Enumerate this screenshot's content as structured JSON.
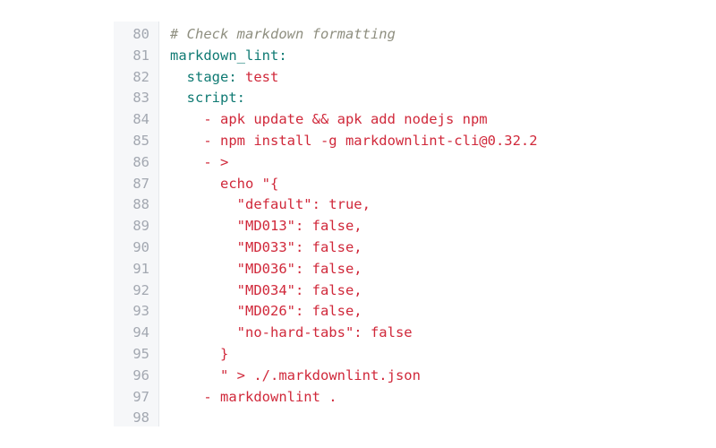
{
  "editor": {
    "lines": [
      {
        "number": "80",
        "indent": "",
        "tokens": [
          {
            "text": "# Check markdown formatting",
            "kind": "comment"
          }
        ]
      },
      {
        "number": "81",
        "indent": "",
        "tokens": [
          {
            "text": "markdown_lint:",
            "kind": "key"
          }
        ]
      },
      {
        "number": "82",
        "indent": "  ",
        "tokens": [
          {
            "text": "stage:",
            "kind": "key"
          },
          {
            "text": " test",
            "kind": "str"
          }
        ]
      },
      {
        "number": "83",
        "indent": "  ",
        "tokens": [
          {
            "text": "script:",
            "kind": "key"
          }
        ]
      },
      {
        "number": "84",
        "indent": "    ",
        "tokens": [
          {
            "text": "- apk update && apk add nodejs npm",
            "kind": "str"
          }
        ]
      },
      {
        "number": "85",
        "indent": "    ",
        "tokens": [
          {
            "text": "- npm install -g markdownlint-cli@0.32.2",
            "kind": "str"
          }
        ]
      },
      {
        "number": "86",
        "indent": "    ",
        "tokens": [
          {
            "text": "- >",
            "kind": "str"
          }
        ]
      },
      {
        "number": "87",
        "indent": "      ",
        "tokens": [
          {
            "text": "echo \"{",
            "kind": "str"
          }
        ]
      },
      {
        "number": "88",
        "indent": "        ",
        "tokens": [
          {
            "text": "\"default\": true,",
            "kind": "str"
          }
        ]
      },
      {
        "number": "89",
        "indent": "        ",
        "tokens": [
          {
            "text": "\"MD013\": false,",
            "kind": "str"
          }
        ]
      },
      {
        "number": "90",
        "indent": "        ",
        "tokens": [
          {
            "text": "\"MD033\": false,",
            "kind": "str"
          }
        ]
      },
      {
        "number": "91",
        "indent": "        ",
        "tokens": [
          {
            "text": "\"MD036\": false,",
            "kind": "str"
          }
        ]
      },
      {
        "number": "92",
        "indent": "        ",
        "tokens": [
          {
            "text": "\"MD034\": false,",
            "kind": "str"
          }
        ]
      },
      {
        "number": "93",
        "indent": "        ",
        "tokens": [
          {
            "text": "\"MD026\": false,",
            "kind": "str"
          }
        ]
      },
      {
        "number": "94",
        "indent": "        ",
        "tokens": [
          {
            "text": "\"no-hard-tabs\": false",
            "kind": "str"
          }
        ]
      },
      {
        "number": "95",
        "indent": "      ",
        "tokens": [
          {
            "text": "}",
            "kind": "str"
          }
        ]
      },
      {
        "number": "96",
        "indent": "      ",
        "tokens": [
          {
            "text": "\" > ./.markdownlint.json",
            "kind": "str"
          }
        ]
      },
      {
        "number": "97",
        "indent": "    ",
        "tokens": [
          {
            "text": "- markdownlint .",
            "kind": "str"
          }
        ]
      },
      {
        "number": "98",
        "indent": "",
        "tokens": []
      }
    ]
  },
  "colors": {
    "comment": "#8f8f80",
    "key": "#0f7a73",
    "string": "#d0283a",
    "line_number": "#a3a8b1",
    "gutter_bg": "#f6f7f9"
  }
}
